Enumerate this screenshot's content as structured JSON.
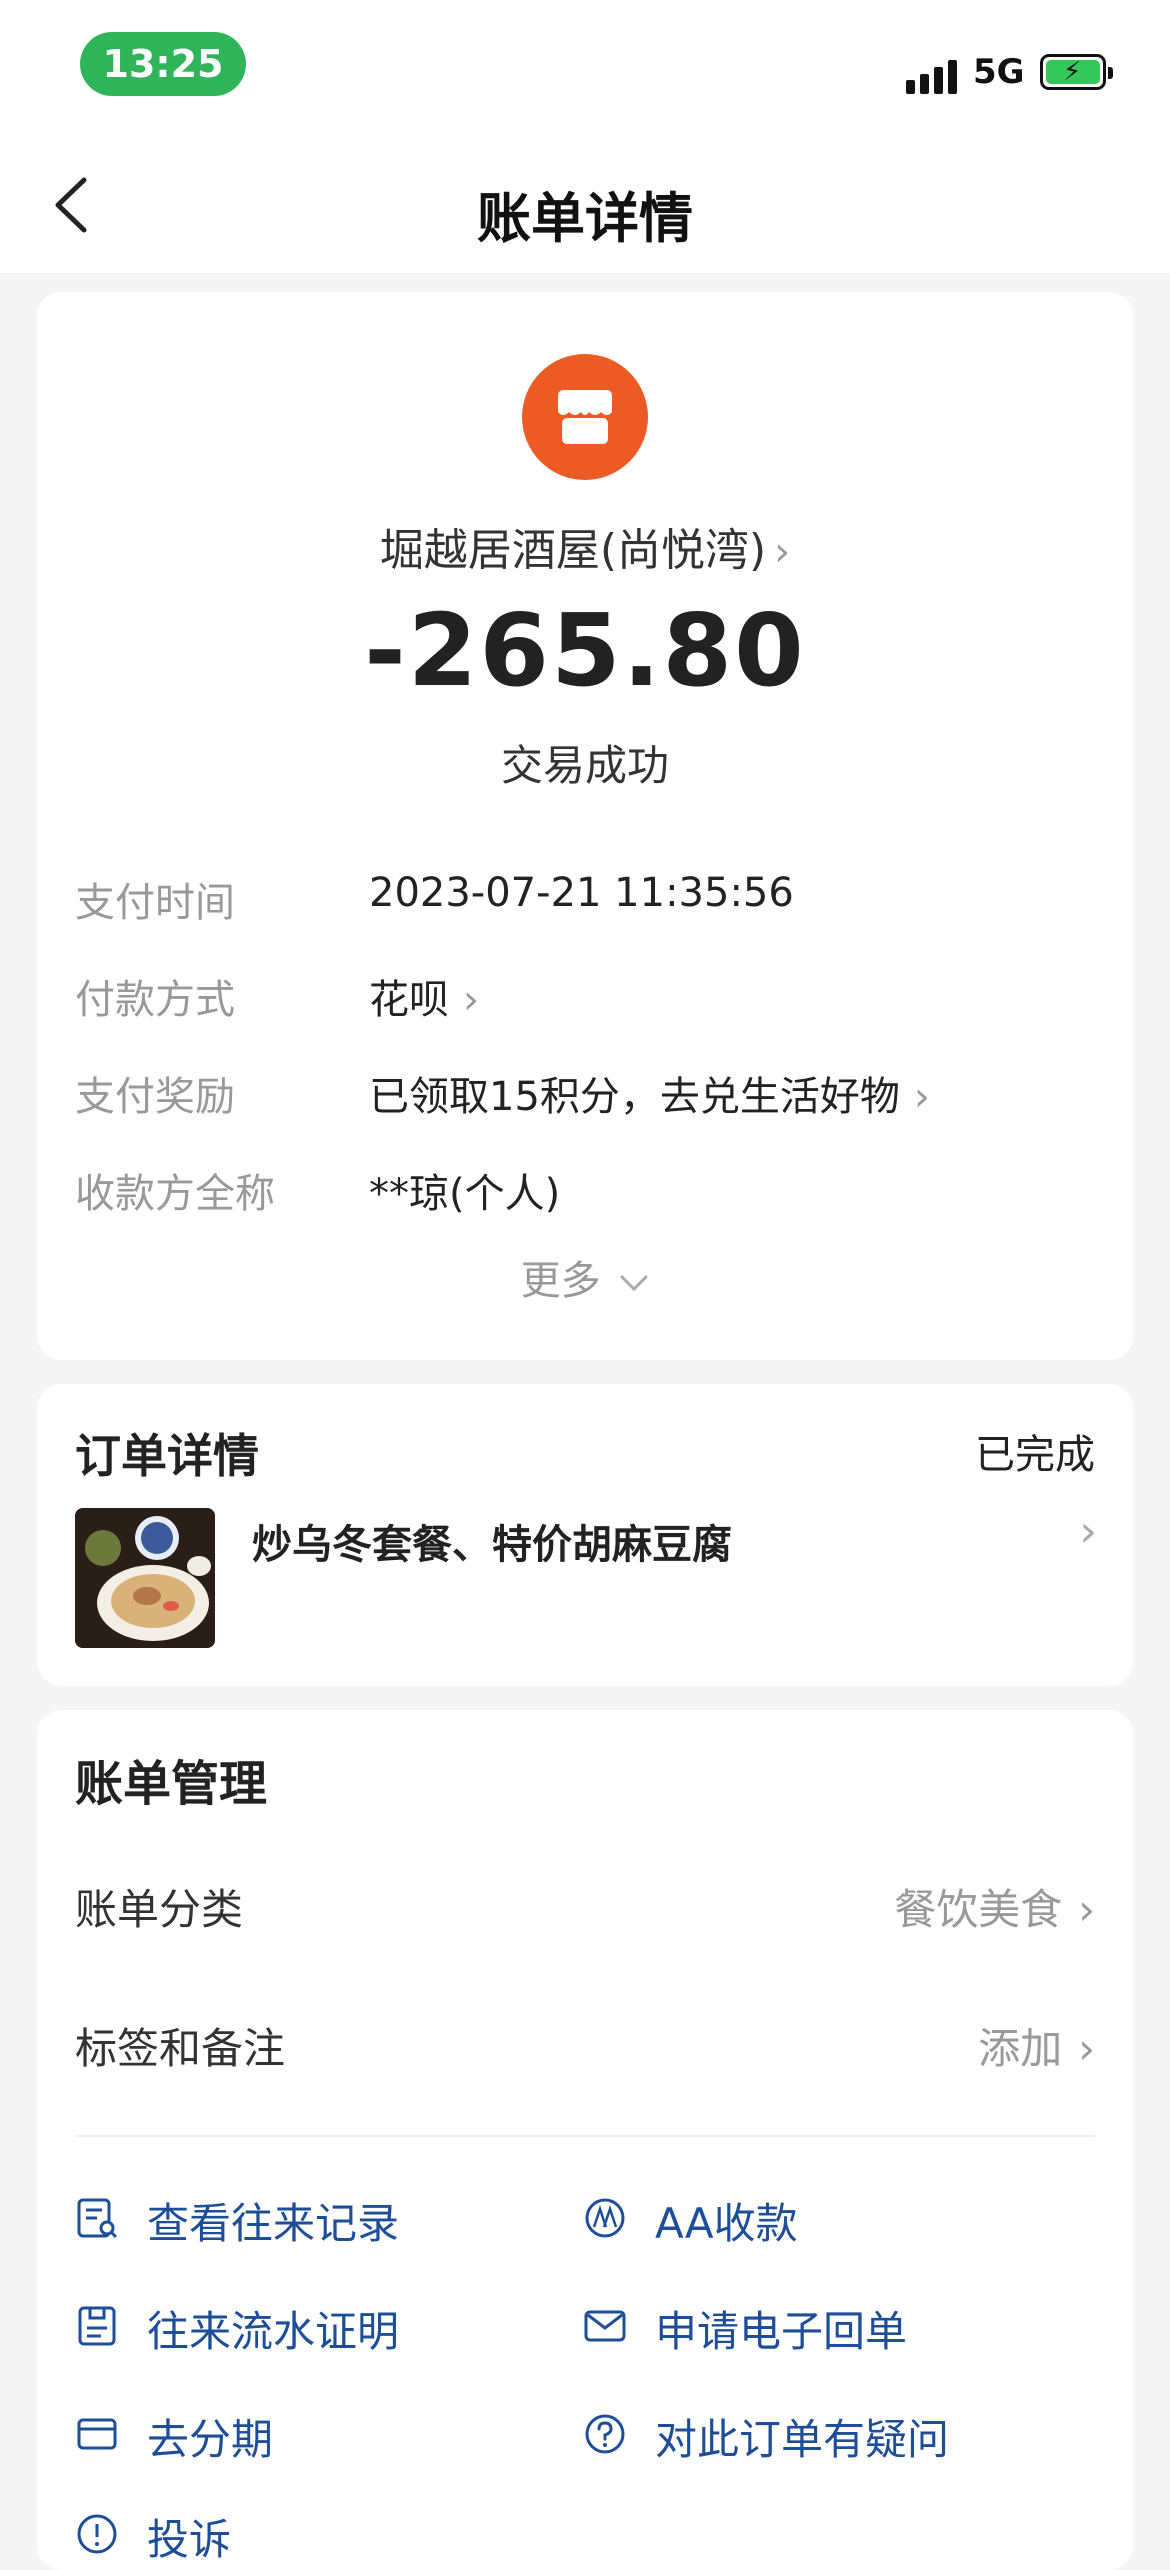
{
  "status_bar": {
    "time": "13:25",
    "network": "5G"
  },
  "nav": {
    "title": "账单详情"
  },
  "transaction": {
    "merchant": "堀越居酒屋(尚悦湾)",
    "amount": "-265.80",
    "status": "交易成功",
    "details": [
      {
        "label": "支付时间",
        "value": "2023-07-21 11:35:56"
      },
      {
        "label": "付款方式",
        "value": "花呗"
      },
      {
        "label": "支付奖励",
        "value": "已领取15积分，去兑生活好物"
      },
      {
        "label": "收款方全称",
        "value": "**琼(个人)"
      }
    ],
    "more_label": "更多"
  },
  "order": {
    "heading": "订单详情",
    "status": "已完成",
    "title": "炒乌冬套餐、特价胡麻豆腐"
  },
  "manage": {
    "heading": "账单管理",
    "category_label": "账单分类",
    "category_value": "餐饮美食",
    "tags_label": "标签和备注",
    "tags_value": "添加",
    "actions": [
      {
        "label": "查看往来记录",
        "icon": "records-icon"
      },
      {
        "label": "AA收款",
        "icon": "aa-icon"
      },
      {
        "label": "往来流水证明",
        "icon": "statement-icon"
      },
      {
        "label": "申请电子回单",
        "icon": "mail-icon"
      },
      {
        "label": "去分期",
        "icon": "card-icon"
      },
      {
        "label": "对此订单有疑问",
        "icon": "question-icon"
      },
      {
        "label": "投诉",
        "icon": "complaint-icon"
      }
    ]
  },
  "colors": {
    "accent": "#1f4e99",
    "logo": "#ed5b25",
    "time_pill": "#2fb45a"
  }
}
